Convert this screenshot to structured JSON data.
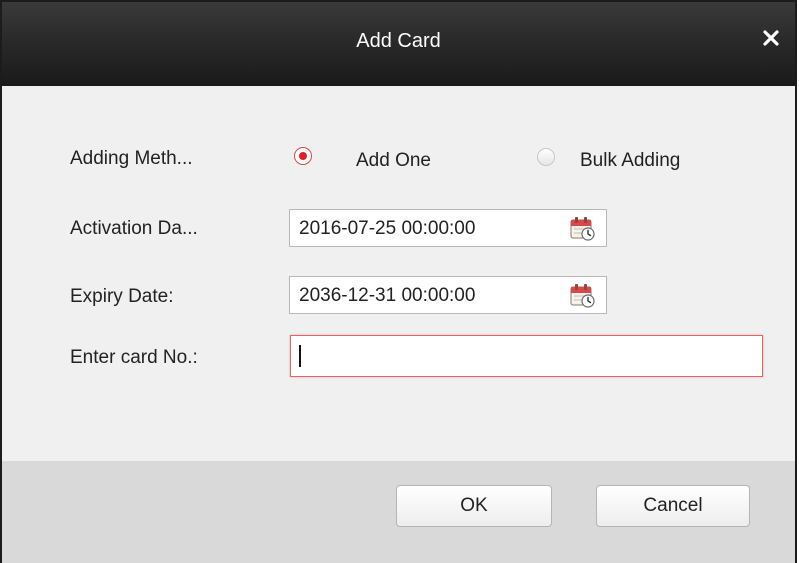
{
  "dialog": {
    "title": "Add Card",
    "close_glyph": "✕"
  },
  "form": {
    "adding_method_label": "Adding Meth...",
    "adding_method_options": [
      {
        "label": "Add One",
        "selected": true
      },
      {
        "label": "Bulk Adding",
        "selected": false
      }
    ],
    "activation_date_label": "Activation Da...",
    "activation_date_value": "2016-07-25 00:00:00",
    "expiry_date_label": "Expiry Date:",
    "expiry_date_value": "2036-12-31 00:00:00",
    "card_no_label": "Enter card No.:",
    "card_no_value": ""
  },
  "buttons": {
    "ok_label": "OK",
    "cancel_label": "Cancel"
  },
  "colors": {
    "titlebar": "#1a1a1a",
    "radio_selected": "#e02020",
    "active_input_border": "#d46b6b",
    "footer": "#d9d9d9"
  },
  "icons": {
    "calendar": "calendar-icon",
    "close": "close-icon"
  }
}
